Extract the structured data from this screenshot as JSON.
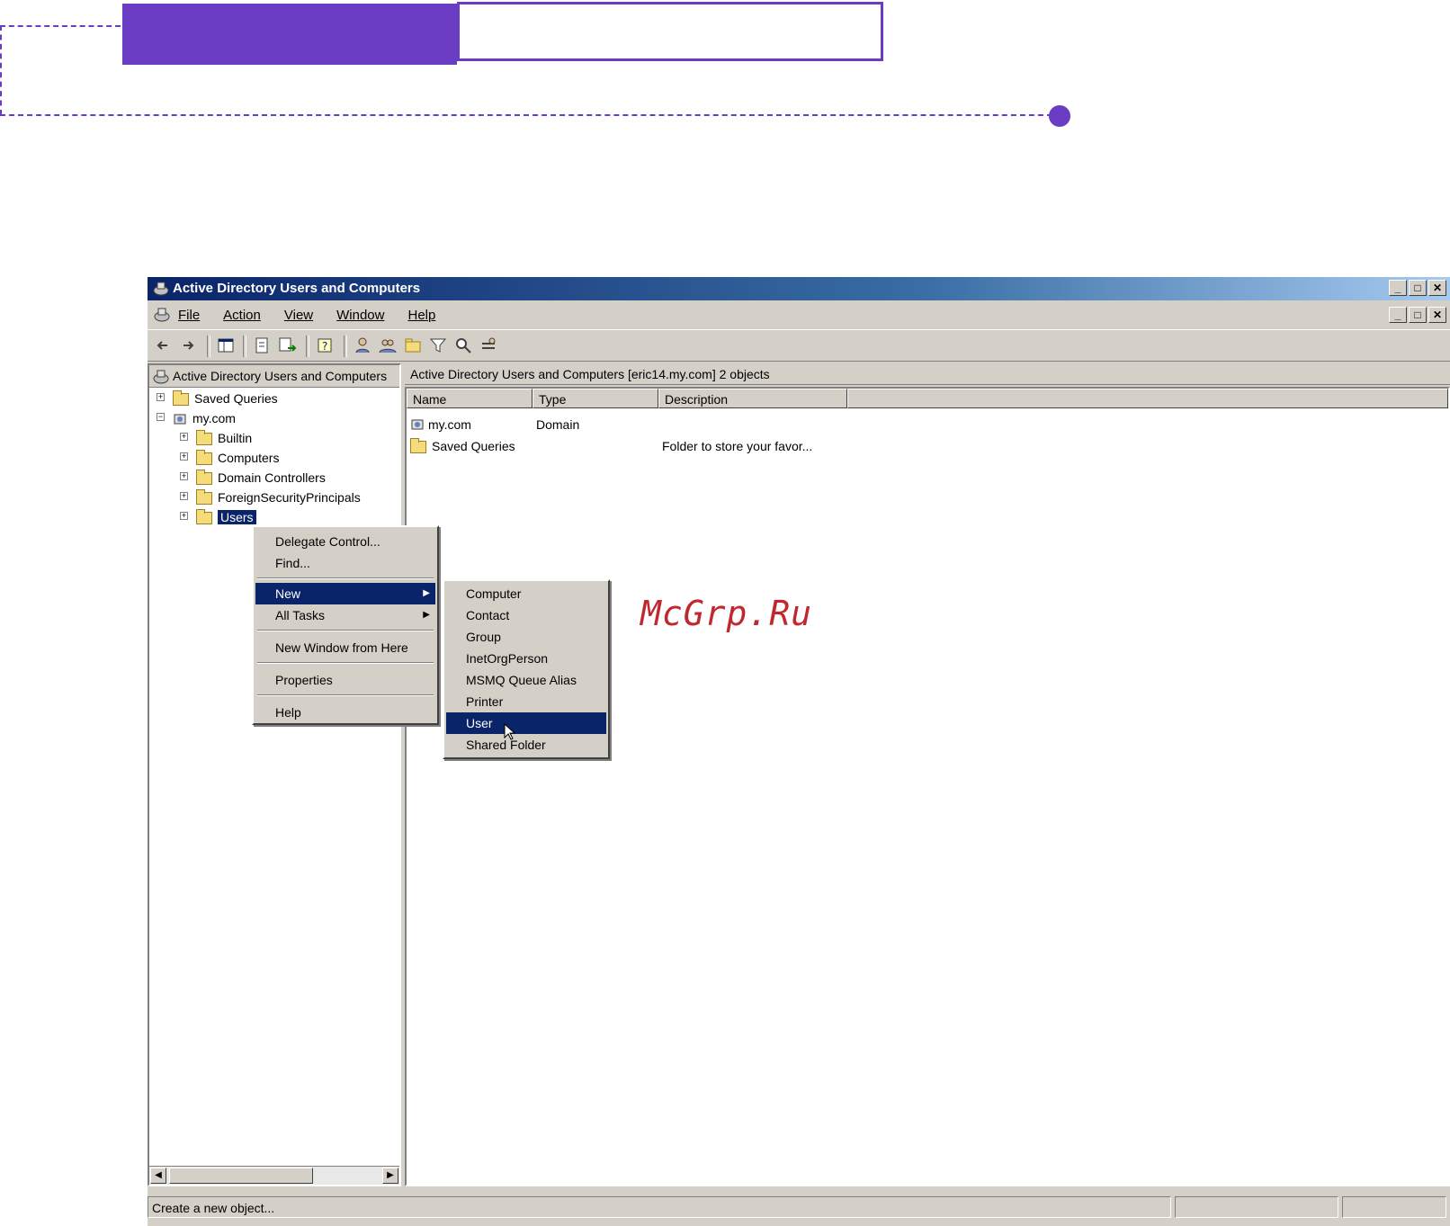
{
  "window": {
    "title": "Active Directory Users and Computers",
    "controls": [
      "_",
      "□",
      "✕"
    ],
    "mdi_controls": [
      "_",
      "□",
      "✕"
    ]
  },
  "menubar": {
    "items": [
      "File",
      "Action",
      "View",
      "Window",
      "Help"
    ]
  },
  "toolbar": {
    "icons": [
      "back-arrow-icon",
      "forward-arrow-icon",
      "show-console-tree-icon",
      "properties-icon",
      "export-list-icon",
      "help-icon",
      "new-user-icon",
      "new-group-icon",
      "new-ou-icon",
      "filter-icon",
      "find-icon",
      "add-to-group-icon"
    ]
  },
  "tree": {
    "header": "Active Directory Users and Computers",
    "nodes": [
      {
        "label": "Saved Queries",
        "expander": "+"
      },
      {
        "label": "my.com",
        "expander": "−"
      },
      {
        "label": "Builtin",
        "expander": "+"
      },
      {
        "label": "Computers",
        "expander": "+"
      },
      {
        "label": "Domain Controllers",
        "expander": "+"
      },
      {
        "label": "ForeignSecurityPrincipals",
        "expander": "+"
      },
      {
        "label": "Users",
        "expander": "+"
      }
    ]
  },
  "list": {
    "header": "Active Directory Users and Computers [eric14.my.com]   2 objects",
    "columns": [
      "Name",
      "Type",
      "Description"
    ],
    "rows": [
      {
        "name": "my.com",
        "type": "Domain",
        "description": ""
      },
      {
        "name": "Saved Queries",
        "type": "",
        "description": "Folder to store your favor..."
      }
    ]
  },
  "context_menu": {
    "items": [
      "Delegate Control...",
      "Find...",
      "New",
      "All Tasks",
      "New Window from Here",
      "Properties",
      "Help"
    ]
  },
  "submenu": {
    "items": [
      "Computer",
      "Contact",
      "Group",
      "InetOrgPerson",
      "MSMQ Queue Alias",
      "Printer",
      "User",
      "Shared Folder"
    ]
  },
  "status": {
    "text": "Create a new object..."
  },
  "watermark": "McGrp.Ru",
  "colors": {
    "accent": "#6a3cc4",
    "title_active": "#0a246a",
    "face": "#d4d0c8",
    "selection": "#0a246a"
  }
}
